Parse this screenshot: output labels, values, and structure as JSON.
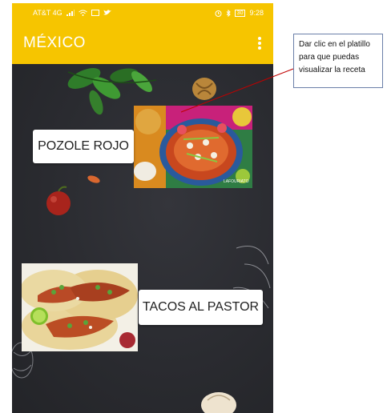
{
  "status_bar": {
    "carrier": "AT&T 4G",
    "battery": "30",
    "time": "9:28"
  },
  "app_bar": {
    "title": "MÉXICO"
  },
  "dishes": [
    {
      "label": "POZOLE ROJO"
    },
    {
      "label": "TACOS AL PASTOR"
    }
  ],
  "pozole_watermark": "LAFOURIATO",
  "annotation": {
    "lines": [
      "Dar clic en el platillo",
      "para que puedas",
      "visualizar la receta"
    ]
  },
  "colors": {
    "accent": "#f6c500",
    "background": "#2b2c31",
    "annotation_line": "#c00000"
  }
}
